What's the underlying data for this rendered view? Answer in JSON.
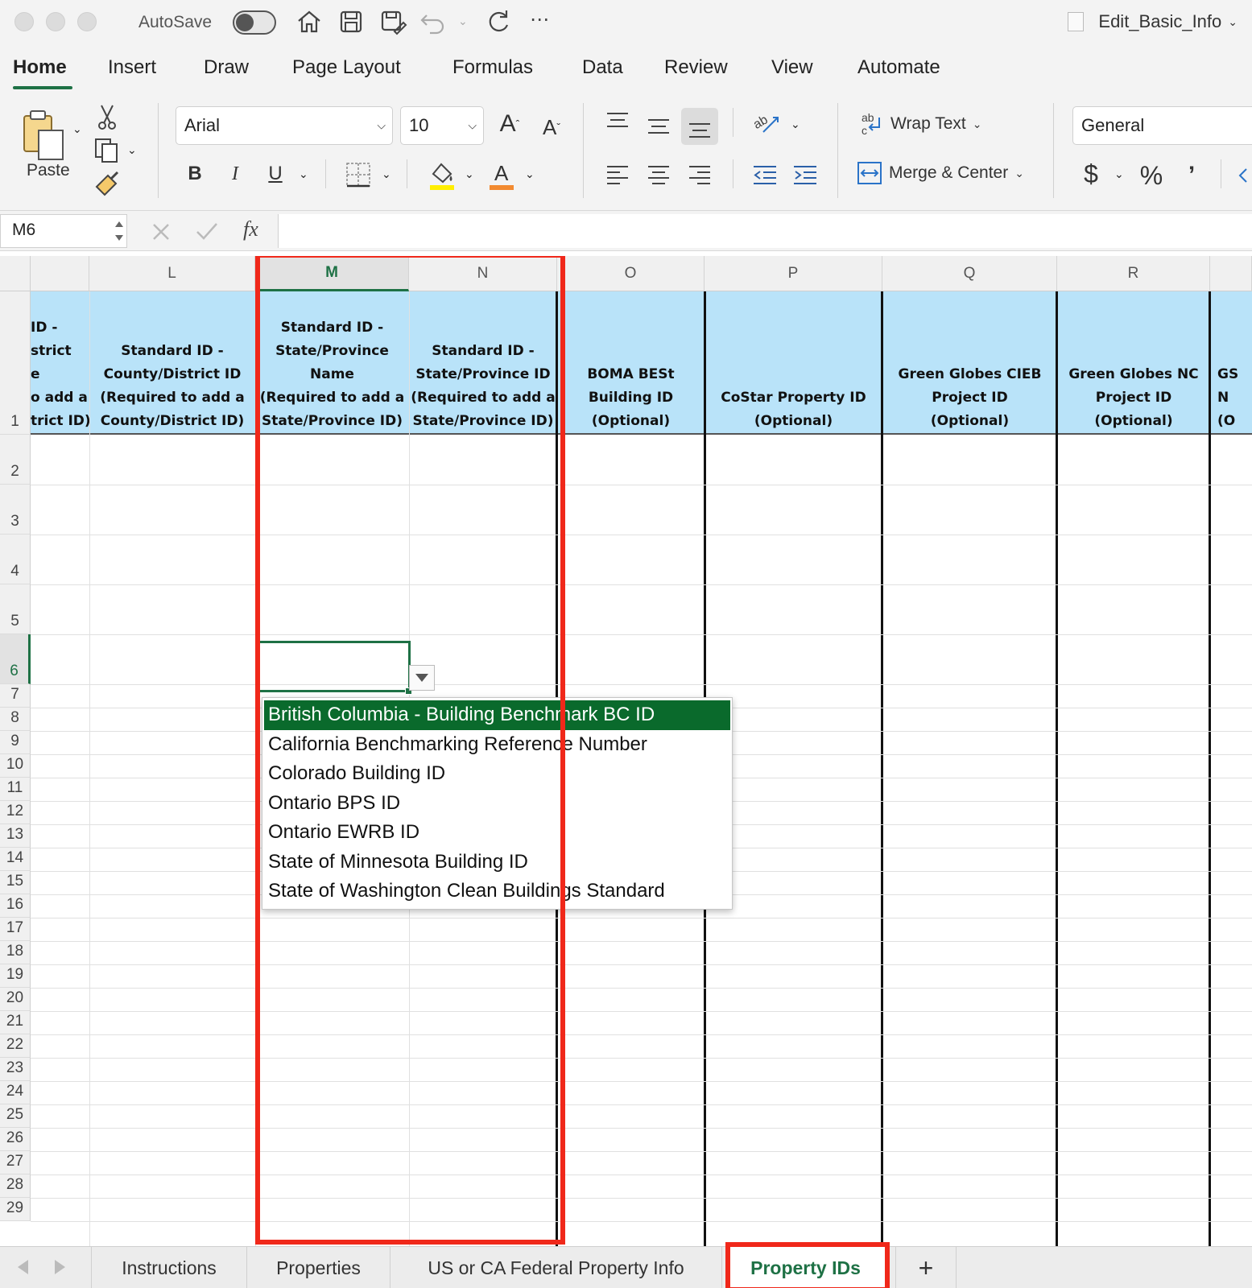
{
  "titlebar": {
    "autosave_label": "AutoSave",
    "file_name": "Edit_Basic_Info"
  },
  "menu_tabs": [
    "Home",
    "Insert",
    "Draw",
    "Page Layout",
    "Formulas",
    "Data",
    "Review",
    "View",
    "Automate"
  ],
  "active_tab": "Home",
  "ribbon": {
    "paste_label": "Paste",
    "font_name": "Arial",
    "font_size": "10",
    "wrap_text_label": "Wrap Text",
    "merge_center_label": "Merge & Center",
    "number_format": "General"
  },
  "formula_bar": {
    "cell_ref": "M6",
    "fx_label": "fx",
    "formula": ""
  },
  "columns": [
    "L",
    "M",
    "N",
    "O",
    "P",
    "Q",
    "R"
  ],
  "header_cells": {
    "k_partial": "ID -\nstrict\ne\no add a\ntrict ID)",
    "l": "Standard ID -\nCounty/District ID\n(Required to add a\nCounty/District ID)",
    "m": "Standard ID -\nState/Province\nName\n(Required to add a\nState/Province ID)",
    "n": "Standard ID -\nState/Province ID\n(Required to add a\nState/Province ID)",
    "o": "BOMA BESt\nBuilding ID\n(Optional)",
    "p": "CoStar Property ID\n(Optional)",
    "q": "Green Globes CIEB\nProject ID\n(Optional)",
    "r": "Green Globes NC\nProject ID\n(Optional)",
    "s_partial": "GS\nN\n(O"
  },
  "rows": [
    "1",
    "2",
    "3",
    "4",
    "5",
    "6",
    "7",
    "8",
    "9",
    "10",
    "11",
    "12",
    "13",
    "14",
    "15",
    "16",
    "17",
    "18",
    "19",
    "20",
    "21",
    "22",
    "23",
    "24",
    "25",
    "26",
    "27",
    "28",
    "29"
  ],
  "dropdown_options": [
    "British Columbia - Building Benchmark BC ID",
    "California Benchmarking Reference Number",
    "Colorado Building ID",
    "Ontario BPS ID",
    "Ontario EWRB ID",
    "State of Minnesota Building ID",
    "State of Washington Clean Buildings Standard"
  ],
  "dropdown_highlighted": "British Columbia - Building Benchmark BC ID",
  "sheet_tabs": [
    "Instructions",
    "Properties",
    "US or CA Federal Property Info",
    "Property IDs"
  ],
  "active_sheet": "Property IDs",
  "add_sheet_label": "+",
  "colors": {
    "accent_green": "#1e7145",
    "header_fill": "#b9e3f9",
    "highlight_red": "#f0281a",
    "dropdown_selected": "#0a6a2c"
  }
}
